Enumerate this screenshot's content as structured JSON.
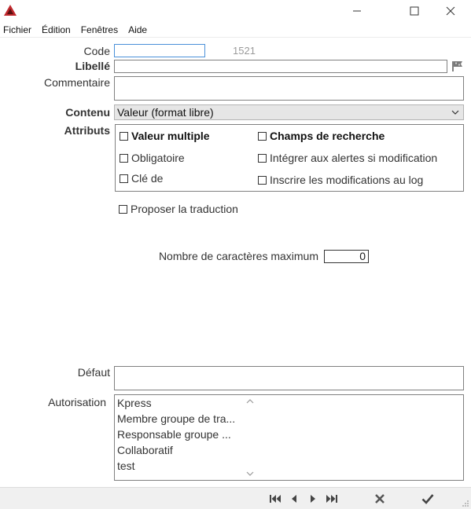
{
  "window": {
    "title": ""
  },
  "menu": [
    "Fichier",
    "Édition",
    "Fenêtres",
    "Aide"
  ],
  "form": {
    "code_label": "Code",
    "code_value": "",
    "code_number": "1521",
    "libelle_label": "Libellé",
    "libelle_value": "",
    "commentaire_label": "Commentaire",
    "commentaire_value": "",
    "contenu_label": "Contenu",
    "contenu_value": "Valeur (format libre)",
    "attributs_label": "Attributs",
    "attributs": {
      "valeur_multiple": "Valeur multiple",
      "champs_recherche": "Champs de recherche",
      "obligatoire": "Obligatoire",
      "integrer_alertes": "Intégrer aux alertes si modification",
      "cle_de": "Clé de",
      "inscrire_log": "Inscrire les modifications au log"
    },
    "proposer_traduction": "Proposer la traduction",
    "max_chars_label": "Nombre de caractères maximum",
    "max_chars_value": "0",
    "defaut_label": "Défaut",
    "defaut_value": "",
    "autorisation_label": "Autorisation",
    "autorisation_items": [
      "Kpress",
      "Membre groupe de tra...",
      "Responsable groupe ...",
      "Collaboratif",
      "test"
    ]
  },
  "icons": {
    "app": "red-triangle-logo-icon",
    "flag": "flag-icon",
    "first": "first-record-icon",
    "prev": "previous-record-icon",
    "next": "next-record-icon",
    "last": "last-record-icon",
    "cancel": "cancel-icon",
    "validate": "validate-check-icon"
  },
  "colors": {
    "accent_red": "#c0282d",
    "focus_blue": "#4a90d9",
    "code_number": "#9a9a9a"
  }
}
